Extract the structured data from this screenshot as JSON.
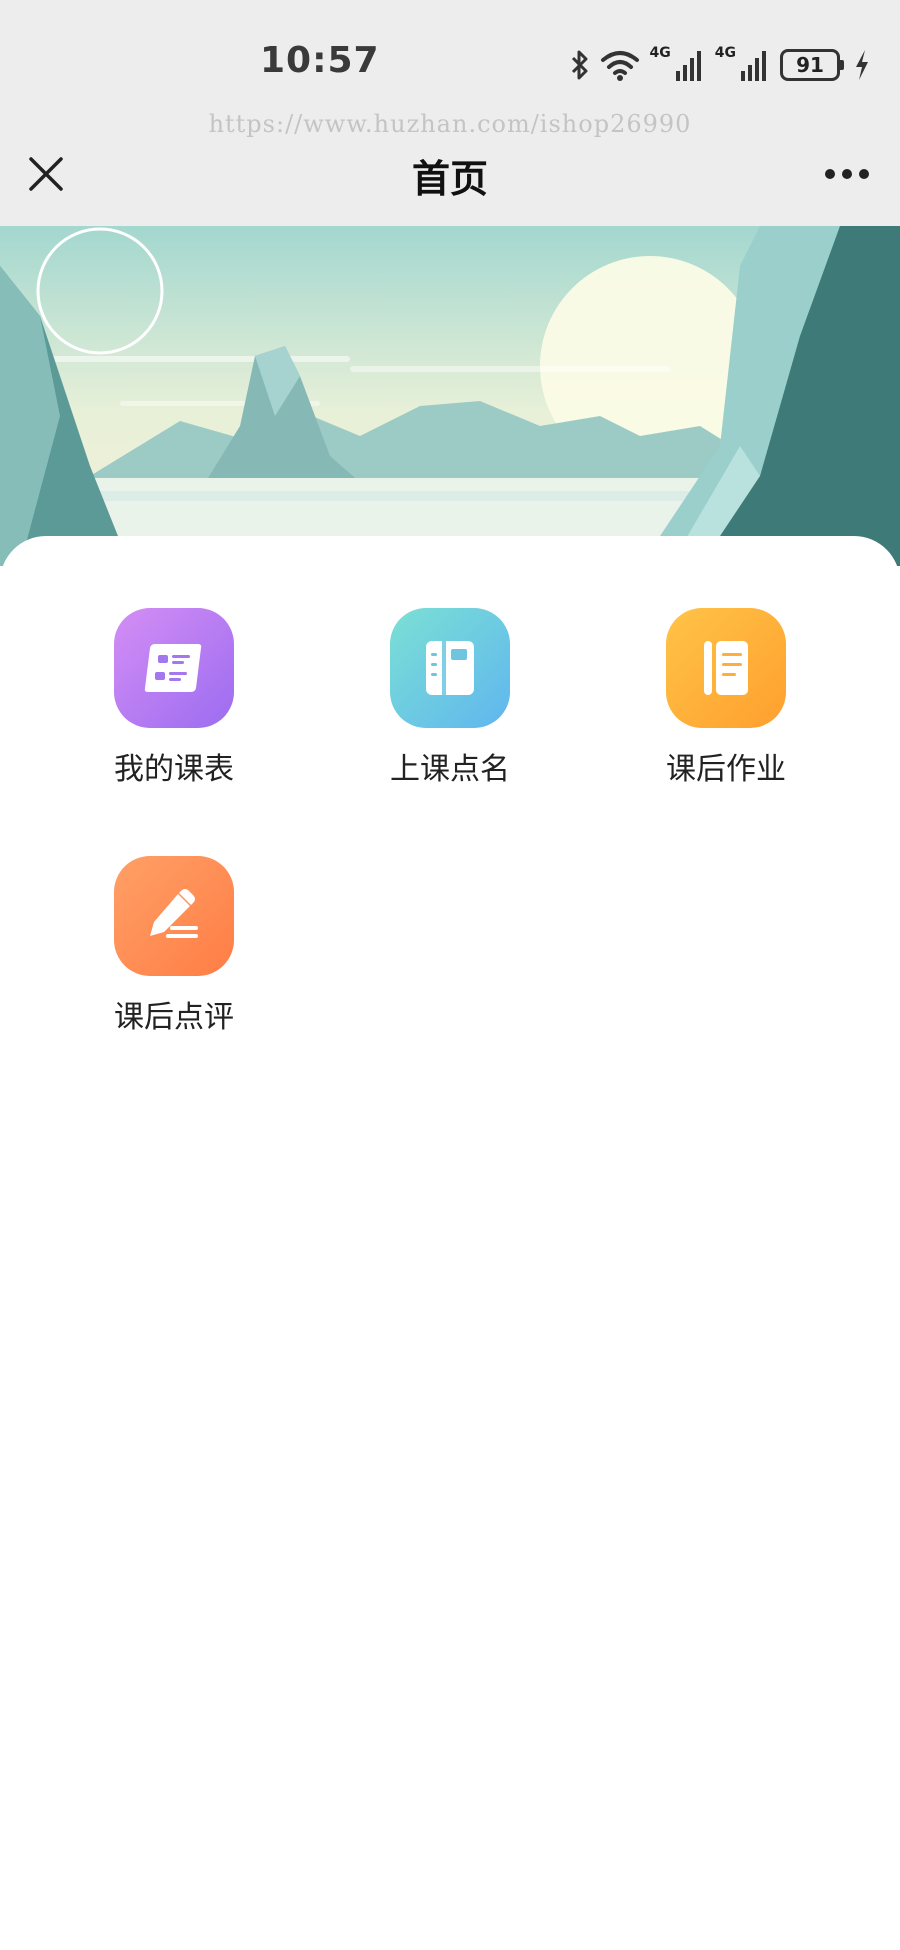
{
  "status_bar": {
    "time": "10:57",
    "network_label_1": "4G",
    "network_label_2": "4G",
    "battery_level": "91",
    "icons": [
      "bluetooth-icon",
      "wifi-icon",
      "signal-icon",
      "signal-icon",
      "battery-icon",
      "charging-icon"
    ]
  },
  "watermark": {
    "url": "https://www.huzhan.com/ishop26990"
  },
  "nav": {
    "title": "首页",
    "close_icon": "close-icon",
    "more_icon": "more-icon"
  },
  "menu": {
    "items": [
      {
        "label": "我的课表",
        "icon": "schedule-icon",
        "color": "#b47cf3"
      },
      {
        "label": "上课点名",
        "icon": "notebook-icon",
        "color": "#6ccbe2"
      },
      {
        "label": "课后作业",
        "icon": "document-icon",
        "color": "#ffb03a"
      },
      {
        "label": "课后点评",
        "icon": "pencil-icon",
        "color": "#ff8e56"
      }
    ]
  }
}
